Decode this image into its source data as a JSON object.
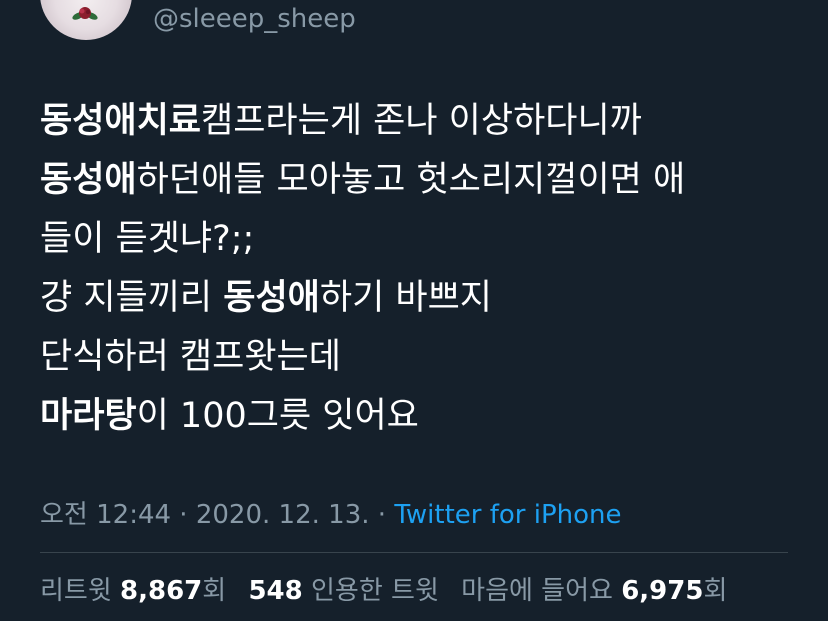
{
  "author": {
    "handle": "@sleeep_sheep"
  },
  "tweet": {
    "lines": [
      {
        "bold": "동성애치료",
        "rest": "캠프라는게 존나 이상하다니까"
      },
      {
        "bold": "동성애",
        "rest": "하던애들 모아놓고 헛소리지껄이면 애"
      },
      {
        "pre": "들이 듣겟냐?;;"
      },
      {
        "pre": "걍 지들끼리 ",
        "bold": "동성애",
        "rest": "하기 바쁘지"
      },
      {
        "pre": "단식하러 캠프왓는데"
      },
      {
        "bold": "마라탕",
        "rest": "이 100그릇 잇어요"
      }
    ]
  },
  "meta": {
    "time": "오전 12:44",
    "sep1": " · ",
    "date": "2020. 12. 13.",
    "sep2": " · ",
    "source": "Twitter for iPhone"
  },
  "stats": {
    "retweet_label": "리트윗",
    "retweet_count": "8,867",
    "retweet_unit": "회",
    "quote_count": "548",
    "quote_label": "인용한 트윗",
    "like_label": "마음에 들어요",
    "like_count": "6,975",
    "like_unit": "회"
  },
  "colors": {
    "background": "#15202b",
    "secondary_text": "#8899a6",
    "link": "#1da1f2",
    "divider": "#38444d"
  }
}
